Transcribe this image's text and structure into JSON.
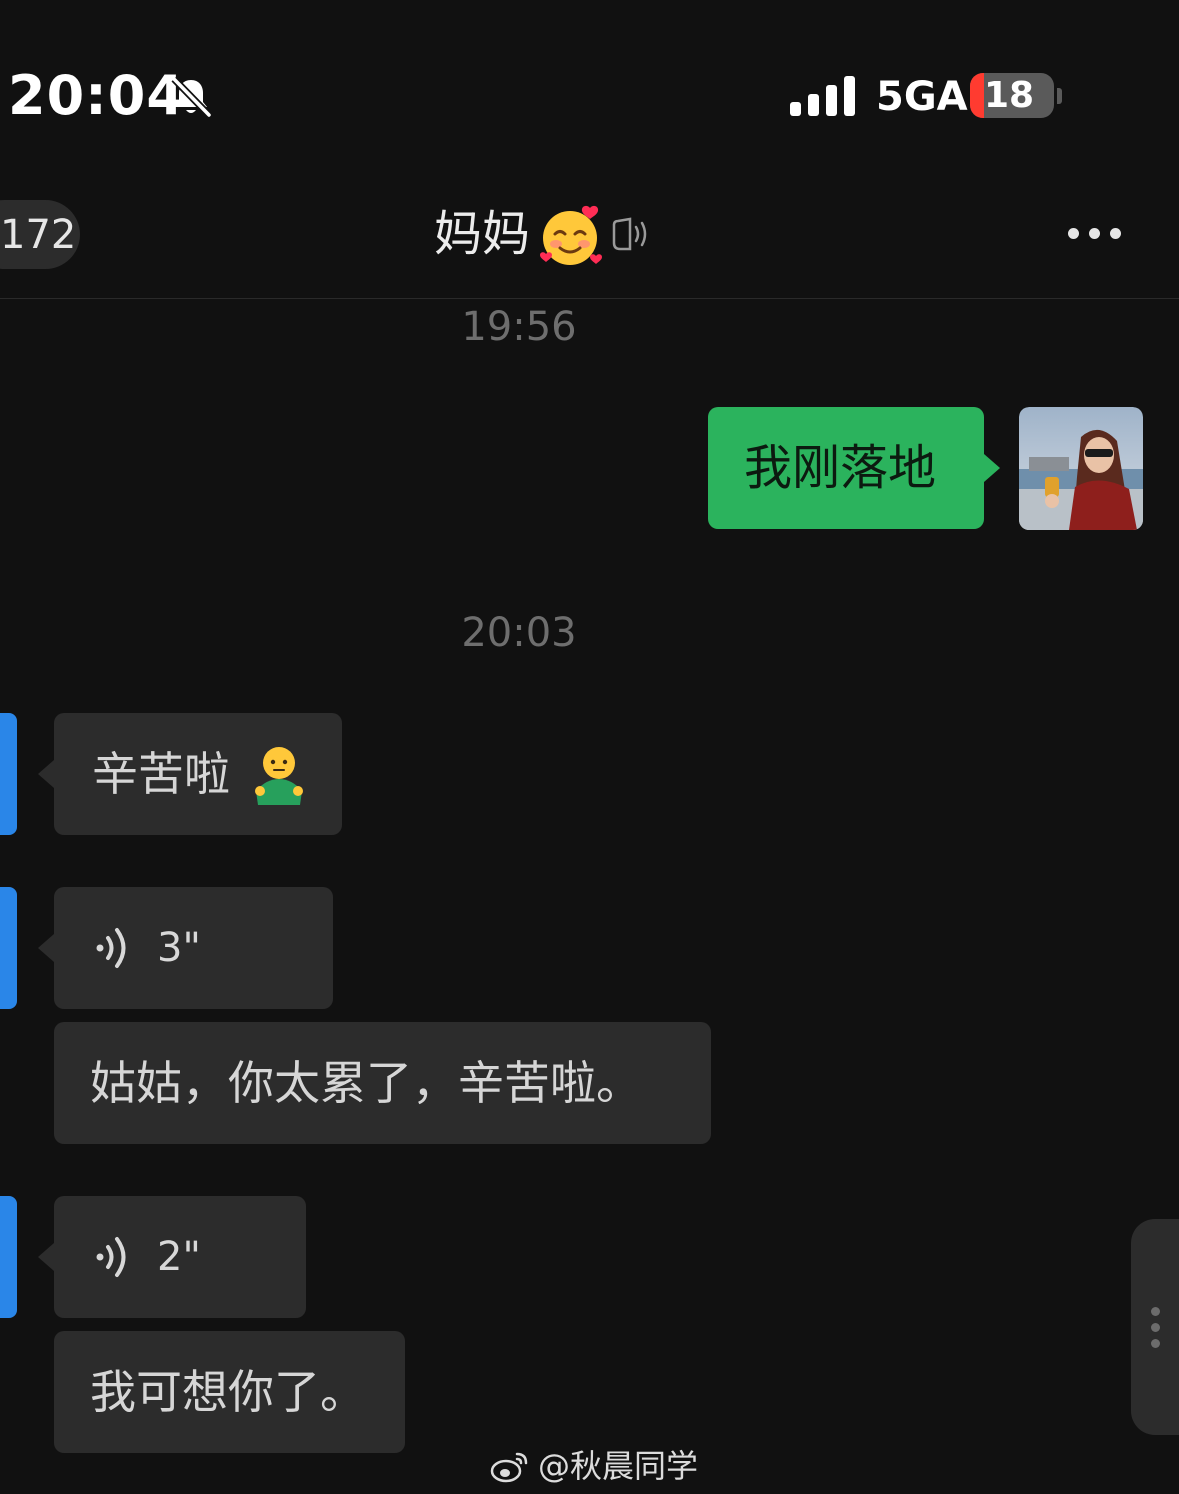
{
  "status_bar": {
    "time": "20:04",
    "network": "5GA",
    "battery": "18",
    "icons": [
      "bell-slash-icon",
      "signal-icon",
      "battery-icon"
    ]
  },
  "header": {
    "back_count": "172",
    "title": "妈妈",
    "title_emoji": "smiling-face-with-hearts",
    "more_icon": "more-icon"
  },
  "messages": [
    {
      "kind": "timestamp",
      "text": "19:56"
    },
    {
      "kind": "sent",
      "text": "我刚落地"
    },
    {
      "kind": "timestamp",
      "text": "20:03"
    },
    {
      "kind": "received",
      "text": "辛苦啦",
      "emoji": "person-shrugging"
    },
    {
      "kind": "voice",
      "duration": "3\"",
      "transcript": "姑姑，你太累了，辛苦啦。"
    },
    {
      "kind": "voice",
      "duration": "2\"",
      "transcript": "我可想你了。"
    }
  ],
  "watermark": "@秋晨同学",
  "colors": {
    "background": "#111111",
    "bubble_received": "#2c2c2c",
    "bubble_sent": "#2bb35d",
    "avatar_left": "#2a86e8"
  }
}
